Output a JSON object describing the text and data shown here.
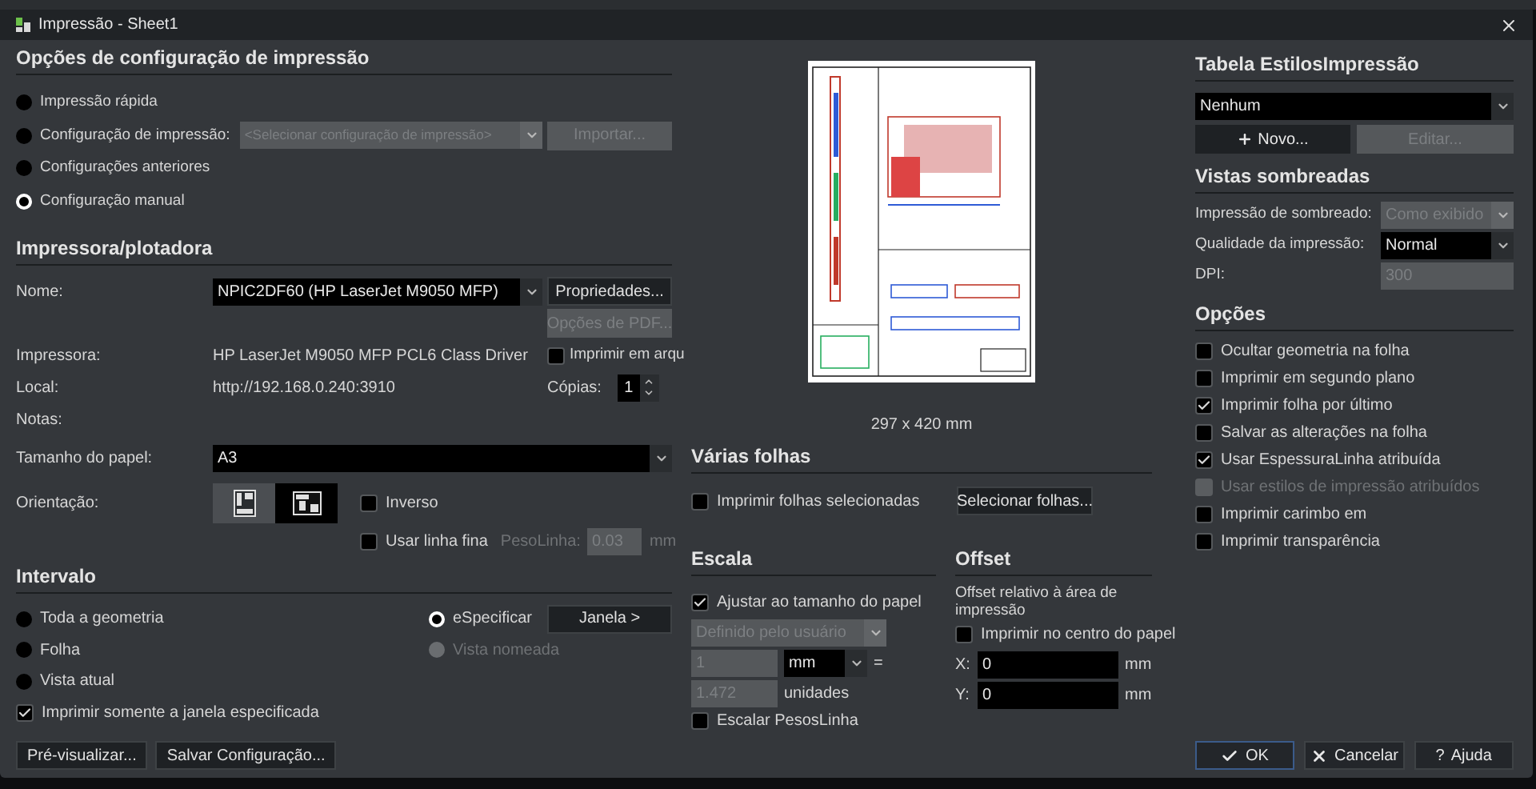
{
  "window": {
    "title": "Impressão - Sheet1"
  },
  "print_setup": {
    "heading": "Opções de configuração de impressão",
    "options": [
      {
        "label": "Impressão rápida",
        "selected": false
      },
      {
        "label": "Configuração de impressão:",
        "selected": false
      },
      {
        "label": "Configurações anteriores",
        "selected": false
      },
      {
        "label": "Configuração manual",
        "selected": true
      }
    ],
    "setup_select": {
      "placeholder": "<Selecionar configuração de impressão>",
      "disabled": true
    },
    "import_button": {
      "label": "Importar...",
      "disabled": true
    }
  },
  "printer": {
    "heading": "Impressora/plotadora",
    "name": {
      "label": "Nome:",
      "value": "NPIC2DF60 (HP LaserJet M9050 MFP)"
    },
    "properties_button": {
      "label": "Propriedades...",
      "disabled": false
    },
    "pdf_button": {
      "label": "Opções de PDF...",
      "disabled": true
    },
    "details": [
      {
        "label": "Impressora:",
        "value": "HP LaserJet M9050 MFP PCL6 Class Driver"
      },
      {
        "label": "Local:",
        "value": "http://192.168.0.240:3910"
      },
      {
        "label": "Notas:"
      }
    ],
    "print_to_file": {
      "label": "Imprimir em arqu",
      "checked": false
    },
    "copies": {
      "label": "Cópias:",
      "value": "1"
    },
    "paper_size": {
      "label": "Tamanho do papel:",
      "value": "A3"
    },
    "orientation": {
      "label": "Orientação:",
      "options": [
        {
          "kind": "portrait",
          "selected": false
        },
        {
          "kind": "landscape",
          "selected": true
        }
      ]
    },
    "reverse": {
      "label": "Inverso",
      "checked": false
    },
    "thin_line": {
      "label": "Usar linha fina",
      "checked": false
    },
    "lineweight": {
      "label": "PesoLinha:",
      "value": "0.03",
      "unit": "mm",
      "disabled": true
    }
  },
  "range": {
    "heading": "Intervalo",
    "options": [
      {
        "label": "Toda a geometria",
        "selected": false,
        "disabled": false
      },
      {
        "label": "Folha",
        "selected": false,
        "disabled": false
      },
      {
        "label": "Vista atual",
        "selected": false,
        "disabled": false
      },
      {
        "label": "eSpecificar",
        "selected": true,
        "disabled": false
      },
      {
        "label": "Vista nomeada",
        "selected": false,
        "disabled": true
      }
    ],
    "window_button": "Janela >",
    "only_window": {
      "label": "Imprimir somente a janela especificada",
      "checked": true
    }
  },
  "footer_buttons": [
    "Pré-visualizar...",
    "Salvar Configuração..."
  ],
  "preview": {
    "size": "297 x 420 mm"
  },
  "multiple_sheets": {
    "heading": "Várias folhas",
    "print_selected": {
      "label": "Imprimir folhas selecionadas",
      "checked": false
    },
    "select_button": "Selecionar folhas..."
  },
  "scale": {
    "heading": "Escala",
    "fit": {
      "label": "Ajustar ao tamanho do papel",
      "checked": true
    },
    "preset": {
      "value": "Definido pelo usuário",
      "disabled": true
    },
    "paper_units": {
      "value": "1",
      "disabled": true
    },
    "unit": "mm",
    "equals": "=",
    "drawing_units": {
      "value": "1.472",
      "disabled": true
    },
    "units_label": "unidades",
    "scale_lineweights": {
      "label": "Escalar PesosLinha",
      "checked": false
    }
  },
  "offset": {
    "heading": "Offset",
    "note": "Offset relativo à área de impressão",
    "center": {
      "label": "Imprimir no centro do papel",
      "checked": false
    },
    "fields": [
      {
        "label": "X:",
        "value": "0",
        "unit": "mm"
      },
      {
        "label": "Y:",
        "value": "0",
        "unit": "mm"
      }
    ]
  },
  "style_table": {
    "heading": "Tabela EstilosImpressão",
    "value": "Nenhum",
    "new_button": {
      "label": "Novo...",
      "disabled": false
    },
    "edit_button": {
      "label": "Editar...",
      "disabled": true
    }
  },
  "shaded_views": {
    "heading": "Vistas sombreadas",
    "fields": [
      {
        "kind": "select",
        "label": "Impressão de sombreado:",
        "value": "Como exibido",
        "disabled": true
      },
      {
        "kind": "select",
        "label": "Qualidade da impressão:",
        "value": "Normal",
        "disabled": false
      },
      {
        "kind": "input",
        "label": "DPI:",
        "value": "300",
        "disabled": true
      }
    ]
  },
  "options": {
    "heading": "Opções",
    "items": [
      {
        "label": "Ocultar geometria na folha",
        "checked": false,
        "disabled": false
      },
      {
        "label": "Imprimir em segundo plano",
        "checked": false,
        "disabled": false
      },
      {
        "label": "Imprimir folha por último",
        "checked": true,
        "disabled": false
      },
      {
        "label": "Salvar as alterações na folha",
        "checked": false,
        "disabled": false
      },
      {
        "label": "Usar EspessuraLinha atribuída",
        "checked": true,
        "disabled": false
      },
      {
        "label": "Usar estilos de impressão atribuídos",
        "checked": false,
        "disabled": true
      },
      {
        "label": "Imprimir carimbo em",
        "checked": false,
        "disabled": false
      },
      {
        "label": "Imprimir transparência",
        "checked": false,
        "disabled": false
      }
    ]
  },
  "dialog_buttons": [
    {
      "kind": "ok",
      "label": "OK"
    },
    {
      "kind": "cancel",
      "label": "Cancelar"
    },
    {
      "kind": "help",
      "label": "Ajuda",
      "glyph": "?"
    }
  ]
}
